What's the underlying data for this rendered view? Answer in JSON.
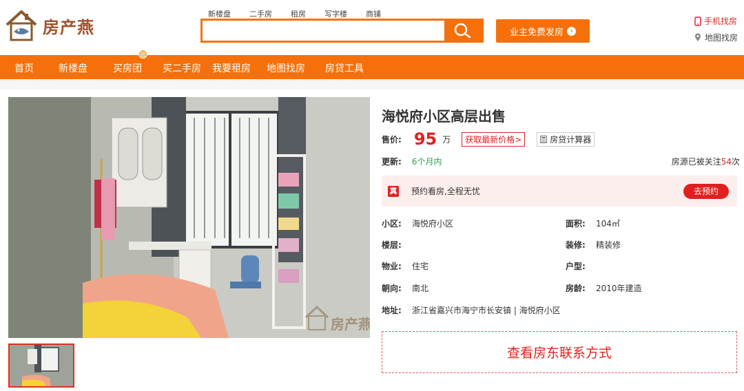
{
  "brand": {
    "name": "房产燕",
    "accent": "#f5700a"
  },
  "search": {
    "tabs": [
      "新楼盘",
      "二手房",
      "租房",
      "写字楼",
      "商铺"
    ],
    "placeholder": ""
  },
  "header": {
    "post_label": "业主免费发房",
    "mobile_label": "手机找房",
    "map_label": "地图找房"
  },
  "nav": {
    "items": [
      "首页",
      "新楼盘",
      "买房团",
      "买二手房",
      "我要租房",
      "地图找房",
      "房贷工具"
    ],
    "badge": "团"
  },
  "listing": {
    "title": "海悦府小区高层出售",
    "price_label": "售价:",
    "price_value": "95",
    "price_unit": "万",
    "price_link": "获取最新价格>",
    "calc_label": "房贷计算器",
    "update_label": "更新:",
    "update_value": "6个月内",
    "follow_prefix": "房源已被关注",
    "follow_count": "54",
    "follow_suffix": "次",
    "visit_icon": "真",
    "visit_text": "预约看房,全程无忧",
    "visit_button": "去预约",
    "contact_button": "查看房东联系方式"
  },
  "details": {
    "community_label": "小区:",
    "community": "海悦府小区",
    "area_label": "面积:",
    "area": "104㎡",
    "floor_label": "楼层:",
    "floor": "",
    "decor_label": "装修:",
    "decor": "精装修",
    "property_label": "物业:",
    "property": "住宅",
    "layout_label": "户型:",
    "layout": "",
    "facing_label": "朝向:",
    "facing": "南北",
    "age_label": "房龄:",
    "age": "2010年建造",
    "address_label": "地址:",
    "address": "浙江省嘉兴市海宁市长安镇 | 海悦府小区"
  },
  "photo": {
    "watermark": "房产燕"
  }
}
